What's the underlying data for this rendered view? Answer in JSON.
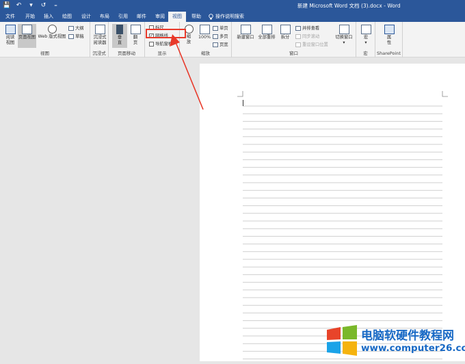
{
  "titlebar": {
    "title": "新建 Microsoft Word 文档 (3).docx - Word",
    "qat": {
      "save": "💾",
      "undo": "↶",
      "undo_arrow": "▾",
      "redo": "↺",
      "customize": "₌"
    }
  },
  "tabs": [
    {
      "id": "file",
      "label": "文件"
    },
    {
      "id": "home",
      "label": "开始"
    },
    {
      "id": "insert",
      "label": "插入"
    },
    {
      "id": "draw",
      "label": "绘图"
    },
    {
      "id": "design",
      "label": "设计"
    },
    {
      "id": "layout",
      "label": "布局"
    },
    {
      "id": "references",
      "label": "引用"
    },
    {
      "id": "mailings",
      "label": "邮件"
    },
    {
      "id": "review",
      "label": "审阅"
    },
    {
      "id": "view",
      "label": "视图"
    },
    {
      "id": "help",
      "label": "帮助"
    }
  ],
  "search": {
    "icon": "lightbulb-icon",
    "label": "操作说明搜索"
  },
  "ribbon": {
    "views": {
      "label": "视图",
      "read_mode": "阅读\n视图",
      "print_layout": "页面视图",
      "web_layout": "Web 版式视图",
      "outline": "大纲",
      "draft": "草稿"
    },
    "immersive": {
      "label": "沉浸式",
      "reader": "沉浸式\n阅读器"
    },
    "page_movement": {
      "label": "页面移动",
      "vertical": "垂\n直",
      "side": "翻\n页"
    },
    "show": {
      "label": "显示",
      "ruler": "标尺",
      "gridlines": "网格线",
      "nav_pane": "导航窗格",
      "gridlines_checked": true
    },
    "zoom": {
      "label": "缩放",
      "zoom": "缩\n放",
      "percent100": "100%",
      "one_page": "单页",
      "multi_page": "多页",
      "page_width": "页宽"
    },
    "window": {
      "label": "窗口",
      "new_window": "新建窗口",
      "arrange_all": "全部重排",
      "split": "拆分",
      "side_by_side": "并排查看",
      "sync_scroll": "同步滚动",
      "reset_position": "重设窗口位置",
      "switch_windows": "切换窗口"
    },
    "macros": {
      "label": "宏",
      "macros": "宏"
    },
    "sharepoint": {
      "label": "SharePoint",
      "properties": "属\n性"
    }
  },
  "watermark": {
    "line1": "电脑软硬件教程网",
    "line2": "www.computer26.com",
    "colors": [
      "#e8442a",
      "#7ab82a",
      "#1aa3e8",
      "#f5b30e"
    ]
  },
  "colors": {
    "accent": "#2b579a",
    "highlight": "#e8392a"
  }
}
